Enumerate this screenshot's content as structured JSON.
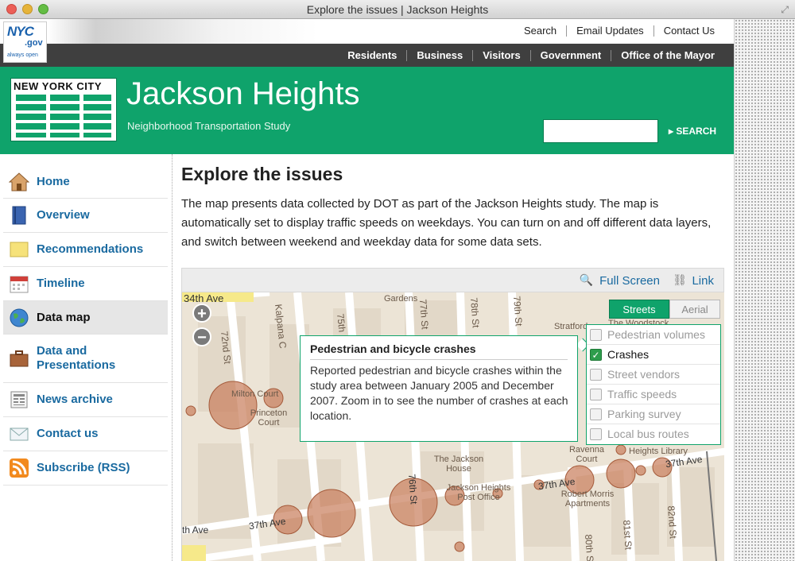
{
  "window": {
    "title": "Explore the issues | Jackson Heights"
  },
  "util_links": [
    "Search",
    "Email Updates",
    "Contact Us"
  ],
  "nav_links": [
    "Residents",
    "Business",
    "Visitors",
    "Government",
    "Office of the Mayor"
  ],
  "logo": {
    "nyc": "NYC",
    "gov": ".gov",
    "tagline": "always open"
  },
  "banner": {
    "dot_logo_text": "NEW YORK CITY",
    "title": "Jackson Heights",
    "subtitle": "Neighborhood Transportation Study",
    "search_value": "",
    "search_button": "SEARCH"
  },
  "sidebar": {
    "items": [
      {
        "label": "Home",
        "icon": "house-icon"
      },
      {
        "label": "Overview",
        "icon": "book-icon"
      },
      {
        "label": "Recommendations",
        "icon": "note-icon"
      },
      {
        "label": "Timeline",
        "icon": "calendar-icon"
      },
      {
        "label": "Data map",
        "icon": "globe-icon"
      },
      {
        "label": "Data and Presentations",
        "icon": "briefcase-icon"
      },
      {
        "label": "News archive",
        "icon": "newspaper-icon"
      },
      {
        "label": "Contact us",
        "icon": "envelope-icon"
      },
      {
        "label": "Subscribe (RSS)",
        "icon": "rss-icon"
      }
    ],
    "active": "Data map"
  },
  "main": {
    "title": "Explore the issues",
    "intro": "The map presents data collected by DOT as part of the Jackson Heights study. The map is automatically set to display traffic speeds on weekdays. You can turn on and off different data layers, and switch between weekend and weekday data for some data sets."
  },
  "map": {
    "fullscreen_label": "Full Screen",
    "link_label": "Link",
    "toggle": {
      "streets": "Streets",
      "aerial": "Aerial"
    },
    "layers": [
      {
        "label": "Pedestrian volumes",
        "checked": false
      },
      {
        "label": "Crashes",
        "checked": true
      },
      {
        "label": "Street vendors",
        "checked": false
      },
      {
        "label": "Traffic speeds",
        "checked": false
      },
      {
        "label": "Parking survey",
        "checked": false
      },
      {
        "label": "Local bus routes",
        "checked": false
      }
    ],
    "popup": {
      "title": "Pedestrian and bicycle crashes",
      "body": "Reported pedestrian and bicycle crashes within the study area between January 2005 and December 2007. Zoom in to see the number of crashes at each location."
    },
    "street_labels": [
      "34th Ave",
      "Kalpana C",
      "75th",
      "Gardens",
      "77th St",
      "78th St",
      "79th St",
      "Stratford",
      "The Woodstock",
      "72nd St",
      "Princeton Court",
      "Milton Court",
      "The Jackson House",
      "Jackson Heights Post Office",
      "Robert Morris Apartments",
      "Ravenna Court",
      "Heights Library",
      "37th Ave",
      "81st St",
      "82nd St",
      "80th St",
      "76th St",
      "th Ave"
    ],
    "colors": {
      "crash_fill": "#c9805e",
      "crash_stroke": "#a45a3a",
      "accent": "#0fa36b"
    }
  }
}
